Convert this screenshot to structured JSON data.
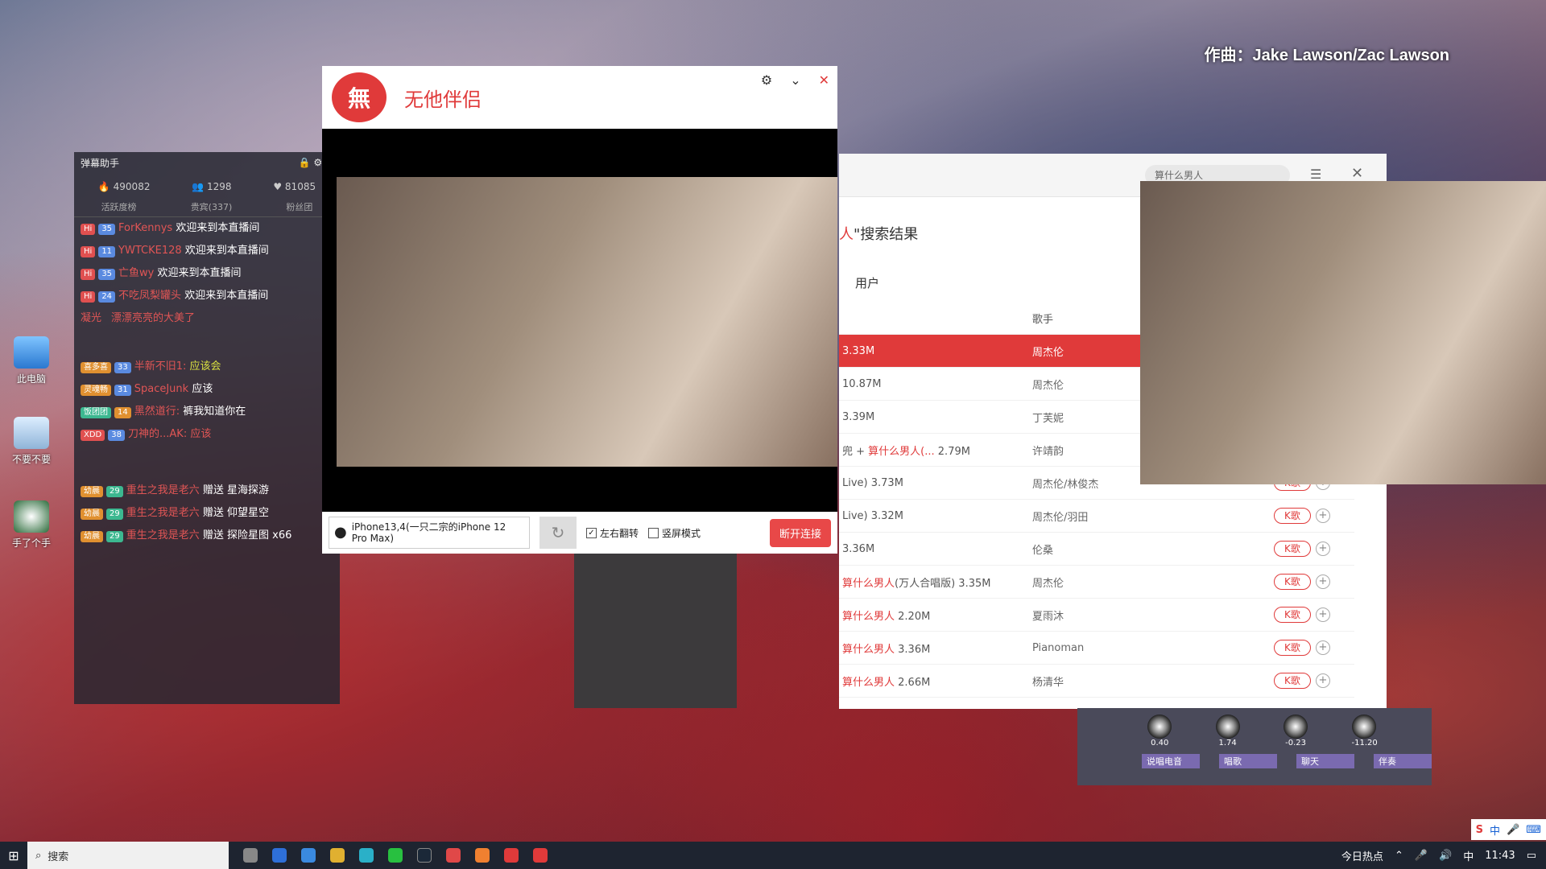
{
  "song_credit": "作曲：Jake Lawson/Zac Lawson",
  "desktop": {
    "icons": [
      {
        "label": "此电脑"
      },
      {
        "label": "不要不要"
      },
      {
        "label": "手了个手"
      }
    ]
  },
  "danmaku": {
    "title": "弹幕助手",
    "stats": {
      "popularity": "490082",
      "viewers": "1298",
      "likes": "81085"
    },
    "tabs": [
      "活跃度榜",
      "贵宾(337)",
      "粉丝团"
    ],
    "messages": [
      {
        "badge": "Hi",
        "level": "35",
        "user": "ForKennys",
        "text": "欢迎来到本直播间"
      },
      {
        "badge": "Hi",
        "level": "11",
        "user": "YWTCKE128",
        "text": "欢迎来到本直播间"
      },
      {
        "badge": "Hi",
        "level": "35",
        "user": "亡鱼wy",
        "text": "欢迎来到本直播间"
      },
      {
        "badge": "Hi",
        "level": "24",
        "user": "不吃凤梨罐头",
        "text": "欢迎来到本直播间"
      },
      {
        "badge": "",
        "level": "",
        "user": "凝光ㅤ漂漂亮亮的大美了",
        "text": ""
      },
      {
        "badge": "喜多喜",
        "level": "33",
        "user": "半新不旧1:",
        "text": "应该会"
      },
      {
        "badge": "灵魂畅",
        "level": "31",
        "user": "SpaceJunk",
        "text": "应该"
      },
      {
        "badge": "饭团团",
        "level": "14",
        "user": "黑然道行:",
        "text": "裤我知道你在"
      },
      {
        "badge": "XDD",
        "level": "38",
        "user": "刀神的...AK:",
        "text": "应该"
      },
      {
        "badge": "幼晨",
        "level": "29",
        "user": "重生之我是老六",
        "text": "赠送 星海探游"
      },
      {
        "badge": "幼晨",
        "level": "29",
        "user": "重生之我是老六",
        "text": "赠送 仰望星空"
      },
      {
        "badge": "幼晨",
        "level": "29",
        "user": "重生之我是老六",
        "text": "赠送 探险星图 x66"
      }
    ]
  },
  "camera_app": {
    "logo": "無",
    "name": "无他伴侣",
    "device": "iPhone13,4(一只二宗的iPhone 12 Pro Max)",
    "flip_label": "左右翻转",
    "flip_checked": true,
    "portrait_label": "竖屏模式",
    "portrait_checked": false,
    "disconnect_label": "断开连接"
  },
  "music": {
    "search_placeholder": "算什么男人",
    "heading_prefix": "人",
    "heading_suffix": "\"搜索结果",
    "tab": "用户",
    "col_singer": "歌手",
    "k_label": "K歌",
    "rows": [
      {
        "title_pre": "",
        "title_hl": "",
        "title_post": "3.33M",
        "singer": "周杰伦",
        "selected": true,
        "has_k": false
      },
      {
        "title_pre": "",
        "title_hl": "",
        "title_post": "10.87M",
        "singer": "周杰伦",
        "selected": false,
        "has_k": false
      },
      {
        "title_pre": "",
        "title_hl": "",
        "title_post": "3.39M",
        "singer": "丁芙妮",
        "selected": false,
        "has_k": false
      },
      {
        "title_pre": "兜 + ",
        "title_hl": "算什么男人(...",
        "title_post": " 2.79M",
        "singer": "许靖韵",
        "selected": false,
        "has_k": false
      },
      {
        "title_pre": "Live) ",
        "title_hl": "",
        "title_post": "3.73M",
        "singer": "周杰伦/林俊杰",
        "selected": false,
        "has_k": true
      },
      {
        "title_pre": "Live) ",
        "title_hl": "",
        "title_post": "3.32M",
        "singer": "周杰伦/羽田",
        "selected": false,
        "has_k": true
      },
      {
        "title_pre": "",
        "title_hl": "",
        "title_post": "3.36M",
        "singer": "伦桑",
        "selected": false,
        "has_k": true
      },
      {
        "title_pre": "",
        "title_hl": "算什么男人",
        "title_post": "(万人合唱版) 3.35M",
        "singer": "周杰伦",
        "selected": false,
        "has_k": true
      },
      {
        "title_pre": "",
        "title_hl": "算什么男人",
        "title_post": " 2.20M",
        "singer": "夏雨沐",
        "selected": false,
        "has_k": true
      },
      {
        "title_pre": "",
        "title_hl": "算什么男人",
        "title_post": " 3.36M",
        "singer": "Pianoman",
        "selected": false,
        "has_k": true
      },
      {
        "title_pre": "",
        "title_hl": "算什么男人",
        "title_post": " 2.66M",
        "singer": "杨清华",
        "selected": false,
        "has_k": true
      }
    ]
  },
  "mixer": {
    "values": [
      "0.40",
      "1.74",
      "-0.23",
      "-11.20"
    ],
    "channels": [
      "说唱电音",
      "唱歌",
      "聊天",
      "伴奏"
    ]
  },
  "taskbar": {
    "search_placeholder": "搜索",
    "hot_label": "今日热点",
    "ime_label": "中",
    "clock": "11:43"
  },
  "ime_bar": {
    "lang": "中"
  },
  "colors": {
    "accent": "#e03a3a",
    "taskbar": "#1e2430"
  }
}
